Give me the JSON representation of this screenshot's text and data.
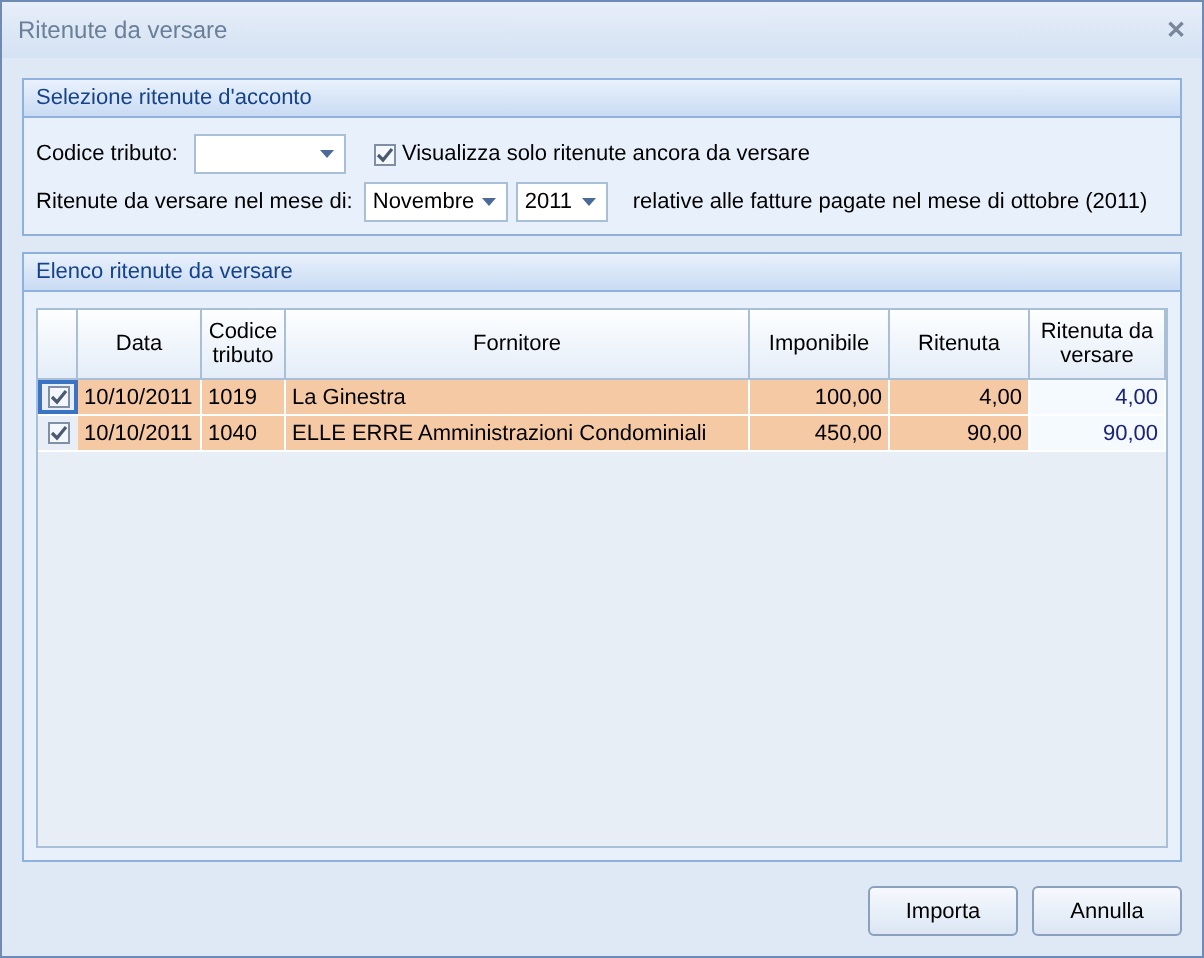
{
  "window": {
    "title": "Ritenute da versare",
    "close": "✕"
  },
  "selection": {
    "title": "Selezione ritenute d'acconto",
    "codice_label": "Codice tributo:",
    "only_pending": {
      "label": "Visualizza solo ritenute ancora da versare",
      "checked": true
    },
    "month_label": "Ritenute da versare nel mese di:",
    "month": "Novembre",
    "year": "2011",
    "note": "relative alle fatture pagate nel mese di ottobre (2011)"
  },
  "list": {
    "title": "Elenco ritenute da versare",
    "columns": [
      "Data",
      "Codice tributo",
      "Fornitore",
      "Imponibile",
      "Ritenuta",
      "Ritenuta da versare"
    ],
    "rows": [
      {
        "checked": true,
        "selected": true,
        "cells": [
          "10/10/2011",
          "1019",
          "La Ginestra",
          "100,00",
          "4,00",
          "4,00"
        ]
      },
      {
        "checked": true,
        "selected": false,
        "cells": [
          "10/10/2011",
          "1040",
          "ELLE ERRE Amministrazioni Condominiali",
          "450,00",
          "90,00",
          "90,00"
        ]
      }
    ]
  },
  "buttons": [
    "Importa",
    "Annulla"
  ]
}
